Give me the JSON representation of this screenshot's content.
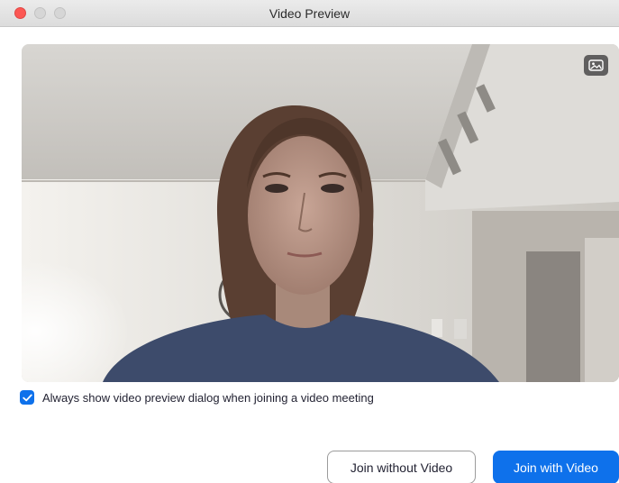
{
  "window": {
    "title": "Video Preview"
  },
  "preview": {
    "background_button_icon": "image-icon"
  },
  "options": {
    "always_show_preview": {
      "label": "Always show video preview dialog when joining a video meeting",
      "checked": true
    }
  },
  "actions": {
    "join_without_video": "Join without Video",
    "join_with_video": "Join with Video"
  },
  "colors": {
    "accent": "#0e71eb",
    "close": "#fc5753"
  }
}
